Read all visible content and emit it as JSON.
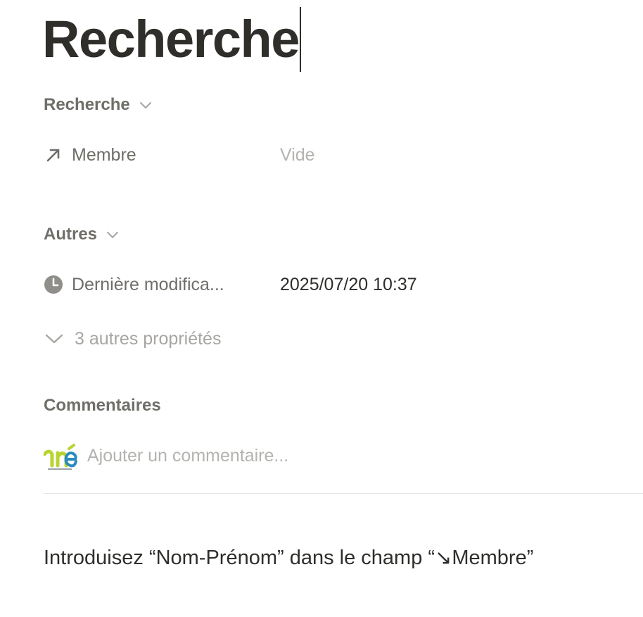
{
  "page": {
    "title": "Recherche"
  },
  "sections": {
    "recherche": {
      "label": "Recherche",
      "properties": [
        {
          "icon": "arrow-up-right-icon",
          "label": "Membre",
          "value": "Vide"
        }
      ]
    },
    "autres": {
      "label": "Autres",
      "properties": [
        {
          "icon": "clock-icon",
          "label": "Dernière modifica...",
          "value": "2025/07/20 10:37"
        }
      ],
      "more_properties_label": "3 autres propriétés"
    }
  },
  "comments": {
    "label": "Commentaires",
    "placeholder": "Ajouter un commentaire..."
  },
  "body": {
    "instruction": "Introduisez “Nom-Prénom” dans le champ “↘Membre”"
  },
  "colors": {
    "text_primary": "#2f2e2b",
    "text_secondary": "#6f6e69",
    "text_placeholder": "#b4b3af",
    "divider": "#e6e5e3"
  }
}
